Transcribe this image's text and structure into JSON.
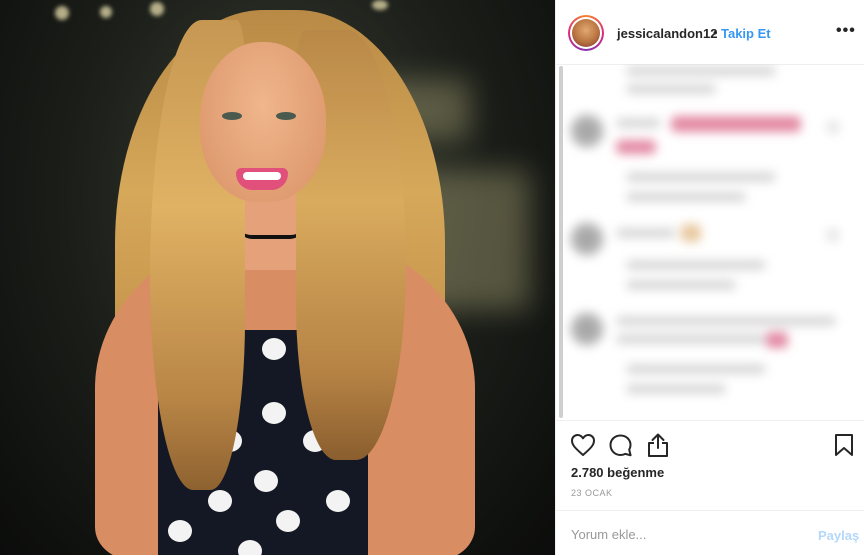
{
  "post": {
    "username": "jessicalandon12",
    "separator": "•",
    "follow_label": "Takip Et",
    "more_label": "•••",
    "likes_text": "2.780 beğenme",
    "date_text": "23 OCAK"
  },
  "icons": {
    "like": "heart-outline-icon",
    "comment": "speech-bubble-icon",
    "share": "share-arrow-icon",
    "save": "bookmark-icon"
  },
  "comment_box": {
    "placeholder": "Yorum ekle...",
    "post_label": "Paylaş"
  },
  "colors": {
    "accent": "#3897f0",
    "text": "#262626",
    "muted": "#999999",
    "post_disabled": "#b3d8fb"
  }
}
